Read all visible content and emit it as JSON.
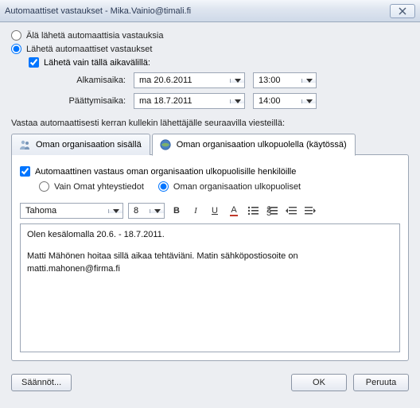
{
  "window": {
    "title": "Automaattiset vastaukset - Mika.Vainio@timali.fi"
  },
  "radios": {
    "no_send": "Älä lähetä automaattisia vastauksia",
    "send": "Lähetä automaattiset vastaukset"
  },
  "timerange": {
    "checkbox": "Lähetä vain tällä aikavälillä:",
    "start_label": "Alkamisaika:",
    "end_label": "Päättymisaika:",
    "start_date": "ma 20.6.2011",
    "start_time": "13:00",
    "end_date": "ma 18.7.2011",
    "end_time": "14:00"
  },
  "summary": "Vastaa automaattisesti kerran kullekin lähettäjälle seuraavilla viesteillä:",
  "tabs": {
    "inside": "Oman organisaation sisällä",
    "outside": "Oman organisaation ulkopuolella (käytössä)"
  },
  "outside_panel": {
    "enable": "Automaattinen vastaus oman organisaation ulkopuolisille henkilöille",
    "only_contacts": "Vain Omat yhteystiedot",
    "all_external": "Oman organisaation ulkopuoliset"
  },
  "toolbar": {
    "font": "Tahoma",
    "size": "8",
    "bold": "B",
    "italic": "I",
    "underline": "U",
    "fontcolor": "A"
  },
  "message": {
    "line1": "Olen kesälomalla 20.6. - 18.7.2011.",
    "line2": "Matti Mähönen hoitaa sillä aikaa tehtäviäni. Matin sähköpostiosoite on matti.mahonen@firma.fi"
  },
  "buttons": {
    "rules": "Säännöt...",
    "ok": "OK",
    "cancel": "Peruuta"
  }
}
